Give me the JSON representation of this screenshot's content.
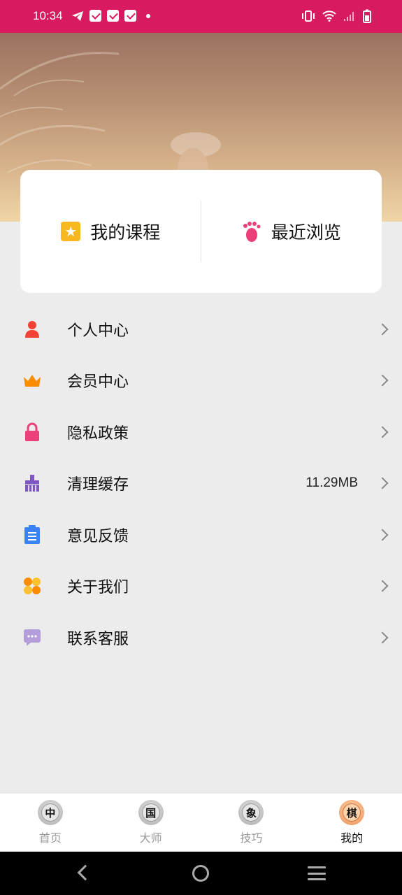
{
  "status_bar": {
    "time": "10:34"
  },
  "card": {
    "my_courses": "我的课程",
    "recent_browse": "最近浏览"
  },
  "menu": [
    {
      "label": "个人中心",
      "icon": "person-icon",
      "value": ""
    },
    {
      "label": "会员中心",
      "icon": "crown-icon",
      "value": ""
    },
    {
      "label": "隐私政策",
      "icon": "lock-icon",
      "value": ""
    },
    {
      "label": "清理缓存",
      "icon": "broom-icon",
      "value": "11.29MB"
    },
    {
      "label": "意见反馈",
      "icon": "clipboard-icon",
      "value": ""
    },
    {
      "label": "关于我们",
      "icon": "clover-icon",
      "value": ""
    },
    {
      "label": "联系客服",
      "icon": "chat-icon",
      "value": ""
    }
  ],
  "tabs": [
    {
      "char": "中",
      "label": "首页",
      "active": false
    },
    {
      "char": "国",
      "label": "大师",
      "active": false
    },
    {
      "char": "象",
      "label": "技巧",
      "active": false
    },
    {
      "char": "棋",
      "label": "我的",
      "active": true
    }
  ],
  "colors": {
    "status_bar": "#d81b60",
    "active_tab": "#e07c3c"
  }
}
